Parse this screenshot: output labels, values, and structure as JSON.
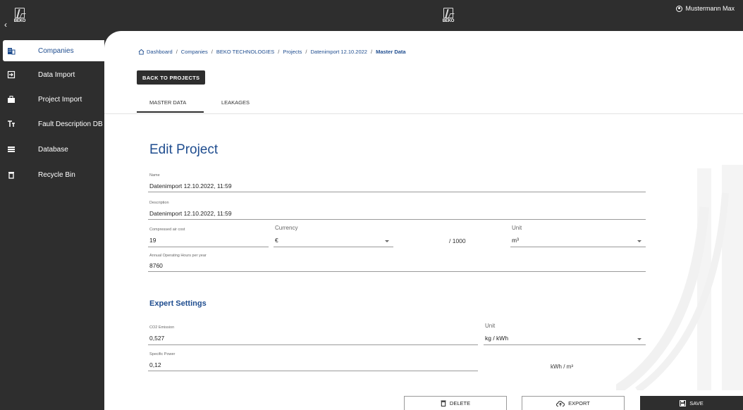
{
  "brand": {
    "logo_text": "BEKO"
  },
  "topbar": {
    "collapse_glyph": "‹",
    "user_name": "Mustermann Max"
  },
  "sidebar": {
    "items": [
      {
        "label": "Companies",
        "icon": "building-icon"
      },
      {
        "label": "Data Import",
        "icon": "import-icon"
      },
      {
        "label": "Project Import",
        "icon": "briefcase-icon"
      },
      {
        "label": "Fault Description DB",
        "icon": "text-format-icon"
      },
      {
        "label": "Database",
        "icon": "list-icon"
      },
      {
        "label": "Recycle Bin",
        "icon": "trash-icon"
      }
    ]
  },
  "breadcrumb": [
    "Dashboard",
    "Companies",
    "BEKO TECHNOLOGIES",
    "Projects",
    "Datenimport 12.10.2022",
    "Master Data"
  ],
  "back_button": "BACK TO PROJECTS",
  "tabs": [
    "MASTER DATA",
    "LEAKAGES"
  ],
  "form": {
    "title": "Edit Project",
    "name": {
      "label": "Name",
      "value": "Datenimport  12.10.2022, 11:59"
    },
    "description": {
      "label": "Description",
      "value": "Datenimport  12.10.2022, 11:59"
    },
    "compressed_air_cost": {
      "label": "Compressed air cost",
      "value": "19"
    },
    "currency": {
      "label": "Currency",
      "value": "€"
    },
    "per_unit_text": "/ 1000",
    "unit": {
      "label": "Unit",
      "value": "m³"
    },
    "operating_hours": {
      "label": "Annual Operating Hours per year",
      "value": "8760"
    },
    "expert_title": "Expert Settings",
    "co2": {
      "label": "CO2 Emission",
      "value": "0,527"
    },
    "co2_unit": {
      "label": "Unit",
      "value": "kg / kWh"
    },
    "specific_power": {
      "label": "Specific Power",
      "value": "0,12"
    },
    "specific_power_unit": "kWh / m³"
  },
  "footer": {
    "delete": "DELETE",
    "export": "EXPORT",
    "save": "SAVE"
  },
  "colors": {
    "accent": "#1f4d8f",
    "dark": "#2e2e2e"
  }
}
